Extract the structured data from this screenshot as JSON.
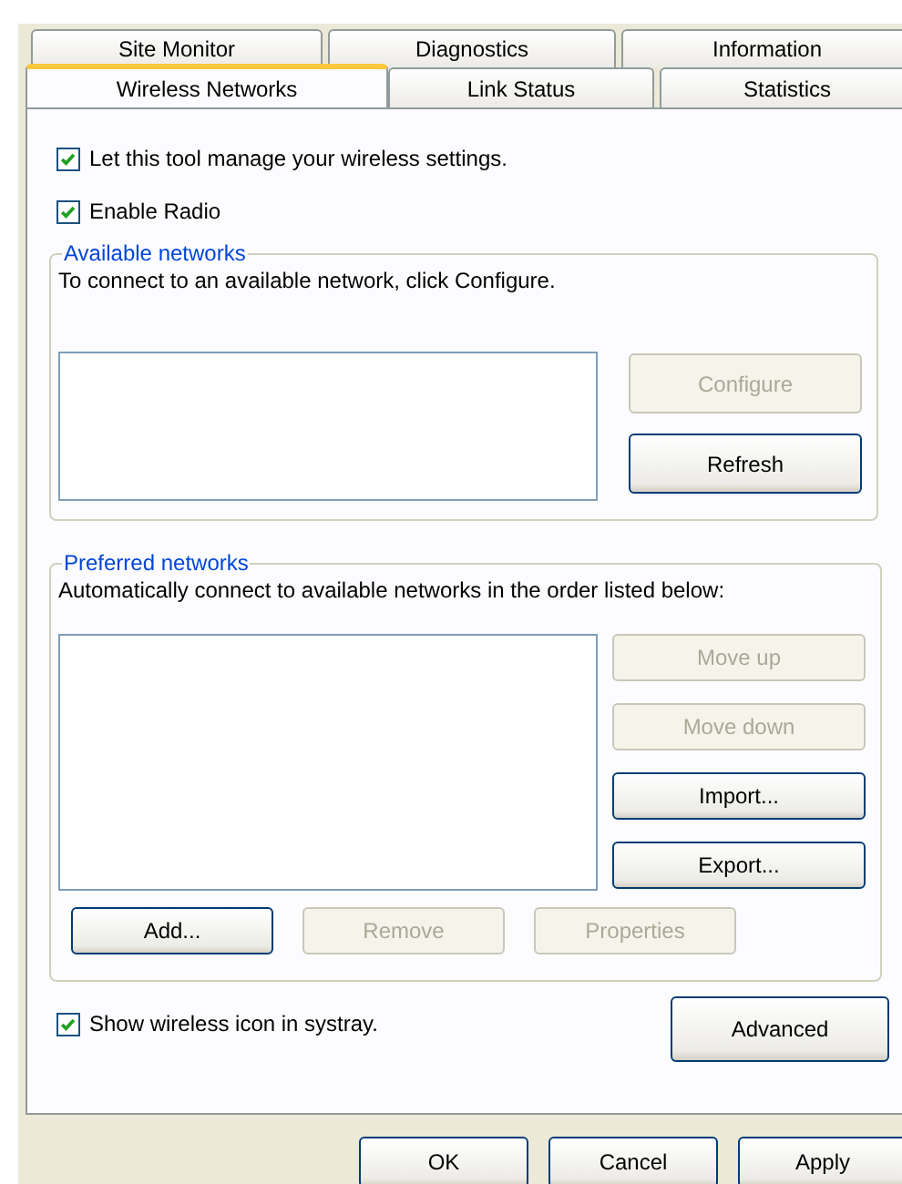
{
  "tabs": {
    "back_row": [
      {
        "label": "Site Monitor",
        "selected": false
      },
      {
        "label": "Diagnostics",
        "selected": false
      },
      {
        "label": "Information",
        "selected": false
      }
    ],
    "front_row": [
      {
        "label": "Wireless Networks",
        "selected": true
      },
      {
        "label": "Link Status",
        "selected": false
      },
      {
        "label": "Statistics",
        "selected": false
      }
    ]
  },
  "options": [
    {
      "label": "Let this tool manage your wireless settings.",
      "checked": true
    },
    {
      "label": "Enable Radio",
      "checked": true
    }
  ],
  "available_networks": {
    "title": "Available networks",
    "description": "To connect to an available network, click Configure.",
    "buttons": [
      {
        "label": "Configure",
        "disabled": true
      },
      {
        "label": "Refresh",
        "disabled": false
      }
    ]
  },
  "preferred_networks": {
    "title": "Preferred networks",
    "description": "Automatically connect to available networks in the order listed below:",
    "side_buttons": [
      {
        "label": "Move up",
        "disabled": true
      },
      {
        "label": "Move down",
        "disabled": true
      },
      {
        "label": "Import...",
        "disabled": false
      },
      {
        "label": "Export...",
        "disabled": false
      }
    ],
    "bottom_buttons": [
      {
        "label": "Add...",
        "disabled": false
      },
      {
        "label": "Remove",
        "disabled": true
      },
      {
        "label": "Properties",
        "disabled": true
      }
    ]
  },
  "systray_option": {
    "label": "Show wireless icon in systray.",
    "checked": true
  },
  "advanced_button": {
    "label": "Advanced",
    "disabled": false
  },
  "dialog_buttons": [
    {
      "label": "OK",
      "disabled": false
    },
    {
      "label": "Cancel",
      "disabled": false
    },
    {
      "label": "Apply",
      "disabled": false
    }
  ]
}
